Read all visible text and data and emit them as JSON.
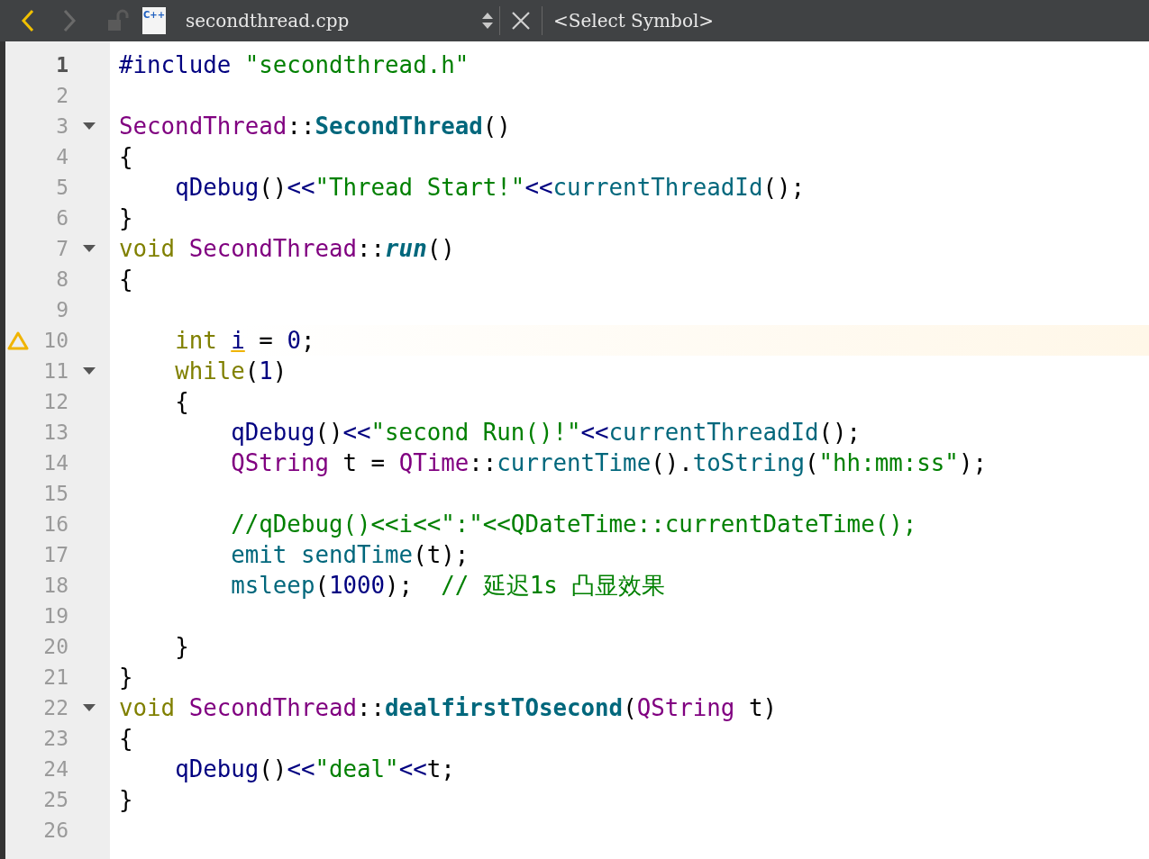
{
  "toolbar": {
    "back": {
      "disabled": false
    },
    "forward": {
      "disabled": true
    },
    "file_icon_label": "C++",
    "file_name": "secondthread.cpp",
    "symbol": "<Select Symbol>"
  },
  "lines": [
    {
      "number": "1",
      "current": true,
      "foldable": false,
      "warning": false,
      "tokens": [
        {
          "kind": "pre",
          "text": "#include"
        },
        {
          "kind": "str",
          "text": " \"secondthread.h\""
        }
      ]
    },
    {
      "number": "2",
      "current": false,
      "foldable": false,
      "warning": false
    },
    {
      "number": "3",
      "current": false,
      "foldable": true,
      "warning": false,
      "tokens": [
        {
          "kind": "type",
          "text": "SecondThread"
        },
        {
          "kind": "plain",
          "text": "::"
        },
        {
          "kind": "decl",
          "text": "SecondThread"
        },
        {
          "kind": "plain",
          "text": "()"
        }
      ]
    },
    {
      "number": "4",
      "current": false,
      "foldable": false,
      "warning": false,
      "tokens": [
        {
          "kind": "plain",
          "text": "{"
        }
      ]
    },
    {
      "number": "5",
      "current": false,
      "foldable": false,
      "warning": false,
      "tokens": [
        {
          "kind": "macro",
          "text": "    qDebug"
        },
        {
          "kind": "plain",
          "text": "()"
        },
        {
          "kind": "op",
          "text": "<<"
        },
        {
          "kind": "str",
          "text": "\"Thread Start!\""
        },
        {
          "kind": "op",
          "text": "<<"
        },
        {
          "kind": "fn",
          "text": "currentThreadId"
        },
        {
          "kind": "plain",
          "text": "();"
        }
      ]
    },
    {
      "number": "6",
      "current": false,
      "foldable": false,
      "warning": false,
      "tokens": [
        {
          "kind": "plain",
          "text": "}"
        }
      ]
    },
    {
      "number": "7",
      "current": false,
      "foldable": true,
      "warning": false,
      "tokens": [
        {
          "kind": "kw",
          "text": "void"
        },
        {
          "kind": "type",
          "text": " SecondThread"
        },
        {
          "kind": "plain",
          "text": "::"
        },
        {
          "kind": "virtual",
          "text": "run"
        },
        {
          "kind": "plain",
          "text": "()"
        }
      ]
    },
    {
      "number": "8",
      "current": false,
      "foldable": false,
      "warning": false,
      "tokens": [
        {
          "kind": "plain",
          "text": "{"
        }
      ]
    },
    {
      "number": "9",
      "current": false,
      "foldable": false,
      "warning": false
    },
    {
      "number": "10",
      "current": false,
      "foldable": false,
      "warning": true,
      "tokens": [
        {
          "kind": "kw",
          "text": "    int"
        },
        {
          "kind": "unused",
          "text": " i"
        },
        {
          "kind": "plain",
          "text": " = "
        },
        {
          "kind": "num",
          "text": "0"
        },
        {
          "kind": "plain",
          "text": ";"
        }
      ]
    },
    {
      "number": "11",
      "current": false,
      "foldable": true,
      "warning": false,
      "tokens": [
        {
          "kind": "kw",
          "text": "    while"
        },
        {
          "kind": "plain",
          "text": "("
        },
        {
          "kind": "num",
          "text": "1"
        },
        {
          "kind": "plain",
          "text": ")"
        }
      ]
    },
    {
      "number": "12",
      "current": false,
      "foldable": false,
      "warning": false,
      "tokens": [
        {
          "kind": "plain",
          "text": "    {"
        }
      ]
    },
    {
      "number": "13",
      "current": false,
      "foldable": false,
      "warning": false,
      "tokens": [
        {
          "kind": "macro",
          "text": "        qDebug"
        },
        {
          "kind": "plain",
          "text": "()"
        },
        {
          "kind": "op",
          "text": "<<"
        },
        {
          "kind": "str",
          "text": "\"second Run()!\""
        },
        {
          "kind": "op",
          "text": "<<"
        },
        {
          "kind": "fn",
          "text": "currentThreadId"
        },
        {
          "kind": "plain",
          "text": "();"
        }
      ]
    },
    {
      "number": "14",
      "current": false,
      "foldable": false,
      "warning": false,
      "tokens": [
        {
          "kind": "type",
          "text": "        QString"
        },
        {
          "kind": "plain",
          "text": " t = "
        },
        {
          "kind": "type",
          "text": "QTime"
        },
        {
          "kind": "plain",
          "text": "::"
        },
        {
          "kind": "fn",
          "text": "currentTime"
        },
        {
          "kind": "plain",
          "text": "()."
        },
        {
          "kind": "fn",
          "text": "toString"
        },
        {
          "kind": "plain",
          "text": "("
        },
        {
          "kind": "str",
          "text": "\"hh:mm:ss\""
        },
        {
          "kind": "plain",
          "text": ");"
        }
      ]
    },
    {
      "number": "15",
      "current": false,
      "foldable": false,
      "warning": false
    },
    {
      "number": "16",
      "current": false,
      "foldable": false,
      "warning": false,
      "tokens": [
        {
          "kind": "cmt",
          "text": "        //qDebug()<<i<<\":\"<<QDateTime::currentDateTime();"
        }
      ]
    },
    {
      "number": "17",
      "current": false,
      "foldable": false,
      "warning": false,
      "tokens": [
        {
          "kind": "fn",
          "text": "        emit"
        },
        {
          "kind": "fn",
          "text": " sendTime"
        },
        {
          "kind": "plain",
          "text": "(t);"
        }
      ]
    },
    {
      "number": "18",
      "current": false,
      "foldable": false,
      "warning": false,
      "tokens": [
        {
          "kind": "fn",
          "text": "        msleep"
        },
        {
          "kind": "plain",
          "text": "("
        },
        {
          "kind": "num",
          "text": "1000"
        },
        {
          "kind": "plain",
          "text": ");"
        },
        {
          "kind": "cmt",
          "text": "  // 延迟1s 凸显效果"
        }
      ]
    },
    {
      "number": "19",
      "current": false,
      "foldable": false,
      "warning": false
    },
    {
      "number": "20",
      "current": false,
      "foldable": false,
      "warning": false,
      "tokens": [
        {
          "kind": "plain",
          "text": "    }"
        }
      ]
    },
    {
      "number": "21",
      "current": false,
      "foldable": false,
      "warning": false,
      "tokens": [
        {
          "kind": "plain",
          "text": "}"
        }
      ]
    },
    {
      "number": "22",
      "current": false,
      "foldable": true,
      "warning": false,
      "tokens": [
        {
          "kind": "kw",
          "text": "void"
        },
        {
          "kind": "type",
          "text": " SecondThread"
        },
        {
          "kind": "plain",
          "text": "::"
        },
        {
          "kind": "decl",
          "text": "dealfirstTOsecond"
        },
        {
          "kind": "plain",
          "text": "("
        },
        {
          "kind": "type",
          "text": "QString"
        },
        {
          "kind": "plain",
          "text": " t)"
        }
      ]
    },
    {
      "number": "23",
      "current": false,
      "foldable": false,
      "warning": false,
      "tokens": [
        {
          "kind": "plain",
          "text": "{"
        }
      ]
    },
    {
      "number": "24",
      "current": false,
      "foldable": false,
      "warning": false,
      "tokens": [
        {
          "kind": "macro",
          "text": "    qDebug"
        },
        {
          "kind": "plain",
          "text": "()"
        },
        {
          "kind": "op",
          "text": "<<"
        },
        {
          "kind": "str",
          "text": "\"deal\""
        },
        {
          "kind": "op",
          "text": "<<"
        },
        {
          "kind": "plain",
          "text": "t;"
        }
      ]
    },
    {
      "number": "25",
      "current": false,
      "foldable": false,
      "warning": false,
      "tokens": [
        {
          "kind": "plain",
          "text": "}"
        }
      ]
    },
    {
      "number": "26",
      "current": false,
      "foldable": false,
      "warning": false
    }
  ]
}
